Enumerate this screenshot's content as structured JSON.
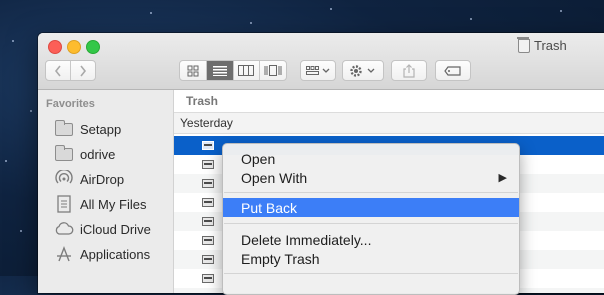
{
  "window": {
    "title": "Trash"
  },
  "toolbar": {
    "back_icon": "chevron-left-icon",
    "forward_icon": "chevron-right-icon",
    "view_modes": [
      "icon-view",
      "list-view",
      "column-view",
      "cover-flow-view"
    ],
    "active_view": "list-view",
    "arrange_icon": "arrange-grid-icon",
    "action_icon": "gear-icon",
    "share_icon": "share-icon",
    "tag_icon": "tag-icon"
  },
  "sidebar": {
    "heading": "Favorites",
    "items": [
      {
        "label": "Setapp",
        "icon": "folder-icon"
      },
      {
        "label": "odrive",
        "icon": "folder-icon"
      },
      {
        "label": "AirDrop",
        "icon": "airdrop-icon"
      },
      {
        "label": "All My Files",
        "icon": "all-files-icon"
      },
      {
        "label": "iCloud Drive",
        "icon": "cloud-icon"
      },
      {
        "label": "Applications",
        "icon": "applications-icon"
      }
    ]
  },
  "main": {
    "path_title": "Trash",
    "group_label": "Yesterday"
  },
  "context_menu": {
    "items": [
      "Open",
      "Open With",
      "Put Back",
      "Delete Immediately...",
      "Empty Trash"
    ],
    "highlighted": "Put Back"
  },
  "colors": {
    "selection": "#0a60c9",
    "menu_highlight": "#3c7ef7",
    "close": "#fc5f57",
    "minimize": "#fdbc2e",
    "zoom": "#33c748"
  }
}
